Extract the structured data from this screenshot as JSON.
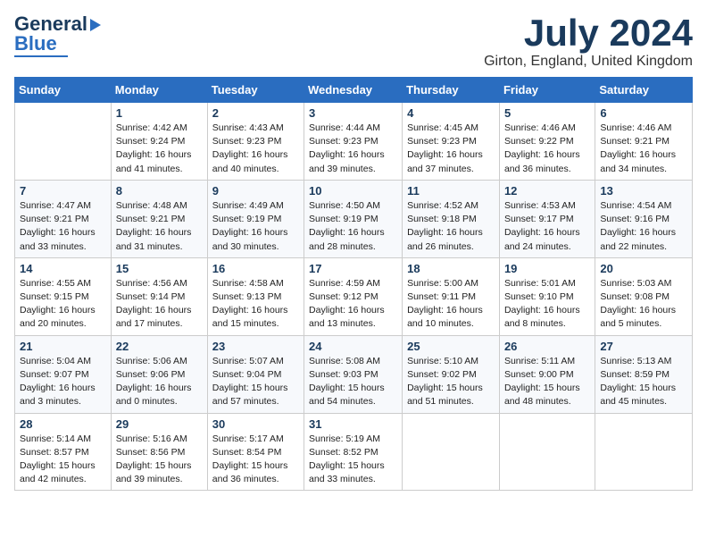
{
  "header": {
    "logo_line1": "General",
    "logo_line2": "Blue",
    "month": "July 2024",
    "location": "Girton, England, United Kingdom"
  },
  "weekdays": [
    "Sunday",
    "Monday",
    "Tuesday",
    "Wednesday",
    "Thursday",
    "Friday",
    "Saturday"
  ],
  "weeks": [
    [
      {
        "day": null
      },
      {
        "day": "1",
        "sunrise": "4:42 AM",
        "sunset": "9:24 PM",
        "daylight": "16 hours and 41 minutes."
      },
      {
        "day": "2",
        "sunrise": "4:43 AM",
        "sunset": "9:23 PM",
        "daylight": "16 hours and 40 minutes."
      },
      {
        "day": "3",
        "sunrise": "4:44 AM",
        "sunset": "9:23 PM",
        "daylight": "16 hours and 39 minutes."
      },
      {
        "day": "4",
        "sunrise": "4:45 AM",
        "sunset": "9:23 PM",
        "daylight": "16 hours and 37 minutes."
      },
      {
        "day": "5",
        "sunrise": "4:46 AM",
        "sunset": "9:22 PM",
        "daylight": "16 hours and 36 minutes."
      },
      {
        "day": "6",
        "sunrise": "4:46 AM",
        "sunset": "9:21 PM",
        "daylight": "16 hours and 34 minutes."
      }
    ],
    [
      {
        "day": "7",
        "sunrise": "4:47 AM",
        "sunset": "9:21 PM",
        "daylight": "16 hours and 33 minutes."
      },
      {
        "day": "8",
        "sunrise": "4:48 AM",
        "sunset": "9:21 PM",
        "daylight": "16 hours and 31 minutes."
      },
      {
        "day": "9",
        "sunrise": "4:49 AM",
        "sunset": "9:19 PM",
        "daylight": "16 hours and 30 minutes."
      },
      {
        "day": "10",
        "sunrise": "4:50 AM",
        "sunset": "9:19 PM",
        "daylight": "16 hours and 28 minutes."
      },
      {
        "day": "11",
        "sunrise": "4:52 AM",
        "sunset": "9:18 PM",
        "daylight": "16 hours and 26 minutes."
      },
      {
        "day": "12",
        "sunrise": "4:53 AM",
        "sunset": "9:17 PM",
        "daylight": "16 hours and 24 minutes."
      },
      {
        "day": "13",
        "sunrise": "4:54 AM",
        "sunset": "9:16 PM",
        "daylight": "16 hours and 22 minutes."
      }
    ],
    [
      {
        "day": "14",
        "sunrise": "4:55 AM",
        "sunset": "9:15 PM",
        "daylight": "16 hours and 20 minutes."
      },
      {
        "day": "15",
        "sunrise": "4:56 AM",
        "sunset": "9:14 PM",
        "daylight": "16 hours and 17 minutes."
      },
      {
        "day": "16",
        "sunrise": "4:58 AM",
        "sunset": "9:13 PM",
        "daylight": "16 hours and 15 minutes."
      },
      {
        "day": "17",
        "sunrise": "4:59 AM",
        "sunset": "9:12 PM",
        "daylight": "16 hours and 13 minutes."
      },
      {
        "day": "18",
        "sunrise": "5:00 AM",
        "sunset": "9:11 PM",
        "daylight": "16 hours and 10 minutes."
      },
      {
        "day": "19",
        "sunrise": "5:01 AM",
        "sunset": "9:10 PM",
        "daylight": "16 hours and 8 minutes."
      },
      {
        "day": "20",
        "sunrise": "5:03 AM",
        "sunset": "9:08 PM",
        "daylight": "16 hours and 5 minutes."
      }
    ],
    [
      {
        "day": "21",
        "sunrise": "5:04 AM",
        "sunset": "9:07 PM",
        "daylight": "16 hours and 3 minutes."
      },
      {
        "day": "22",
        "sunrise": "5:06 AM",
        "sunset": "9:06 PM",
        "daylight": "16 hours and 0 minutes."
      },
      {
        "day": "23",
        "sunrise": "5:07 AM",
        "sunset": "9:04 PM",
        "daylight": "15 hours and 57 minutes."
      },
      {
        "day": "24",
        "sunrise": "5:08 AM",
        "sunset": "9:03 PM",
        "daylight": "15 hours and 54 minutes."
      },
      {
        "day": "25",
        "sunrise": "5:10 AM",
        "sunset": "9:02 PM",
        "daylight": "15 hours and 51 minutes."
      },
      {
        "day": "26",
        "sunrise": "5:11 AM",
        "sunset": "9:00 PM",
        "daylight": "15 hours and 48 minutes."
      },
      {
        "day": "27",
        "sunrise": "5:13 AM",
        "sunset": "8:59 PM",
        "daylight": "15 hours and 45 minutes."
      }
    ],
    [
      {
        "day": "28",
        "sunrise": "5:14 AM",
        "sunset": "8:57 PM",
        "daylight": "15 hours and 42 minutes."
      },
      {
        "day": "29",
        "sunrise": "5:16 AM",
        "sunset": "8:56 PM",
        "daylight": "15 hours and 39 minutes."
      },
      {
        "day": "30",
        "sunrise": "5:17 AM",
        "sunset": "8:54 PM",
        "daylight": "15 hours and 36 minutes."
      },
      {
        "day": "31",
        "sunrise": "5:19 AM",
        "sunset": "8:52 PM",
        "daylight": "15 hours and 33 minutes."
      },
      {
        "day": null
      },
      {
        "day": null
      },
      {
        "day": null
      }
    ]
  ]
}
